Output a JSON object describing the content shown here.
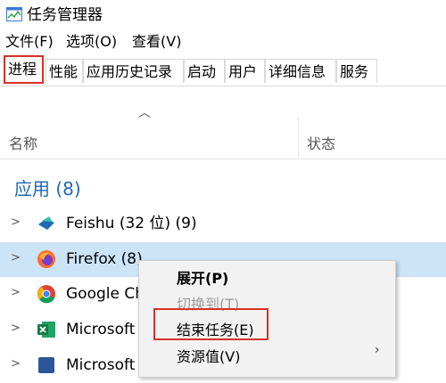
{
  "window": {
    "title": "任务管理器"
  },
  "menu": [
    "文件(F)",
    "选项(O)",
    "查看(V)"
  ],
  "tabs": [
    "进程",
    "性能",
    "应用历史记录",
    "启动",
    "用户",
    "详细信息",
    "服务"
  ],
  "columns": {
    "name": "名称",
    "status": "状态"
  },
  "group": {
    "label": "应用 (8)"
  },
  "rows": [
    {
      "label": "Feishu (32 位) (9)",
      "icon": "feishu-icon"
    },
    {
      "label": "Firefox (8)",
      "icon": "firefox-icon",
      "selected": true
    },
    {
      "label": "Google Ch",
      "icon": "chrome-icon"
    },
    {
      "label": "Microsoft",
      "icon": "excel-icon"
    },
    {
      "label": "Microsoft",
      "icon": "app-icon"
    }
  ],
  "context_menu": {
    "items": [
      {
        "label": "展开(P)",
        "style": "bold"
      },
      {
        "label": "切换到(T)",
        "style": "disabled"
      },
      {
        "label": "结束任务(E)",
        "style": "normal"
      },
      {
        "label": "资源值(V)",
        "style": "normal",
        "submenu": true
      }
    ]
  },
  "colors": {
    "accent_blue": "#1e6ab4",
    "highlight_red": "#d7302a",
    "selection": "#cce4f7"
  }
}
